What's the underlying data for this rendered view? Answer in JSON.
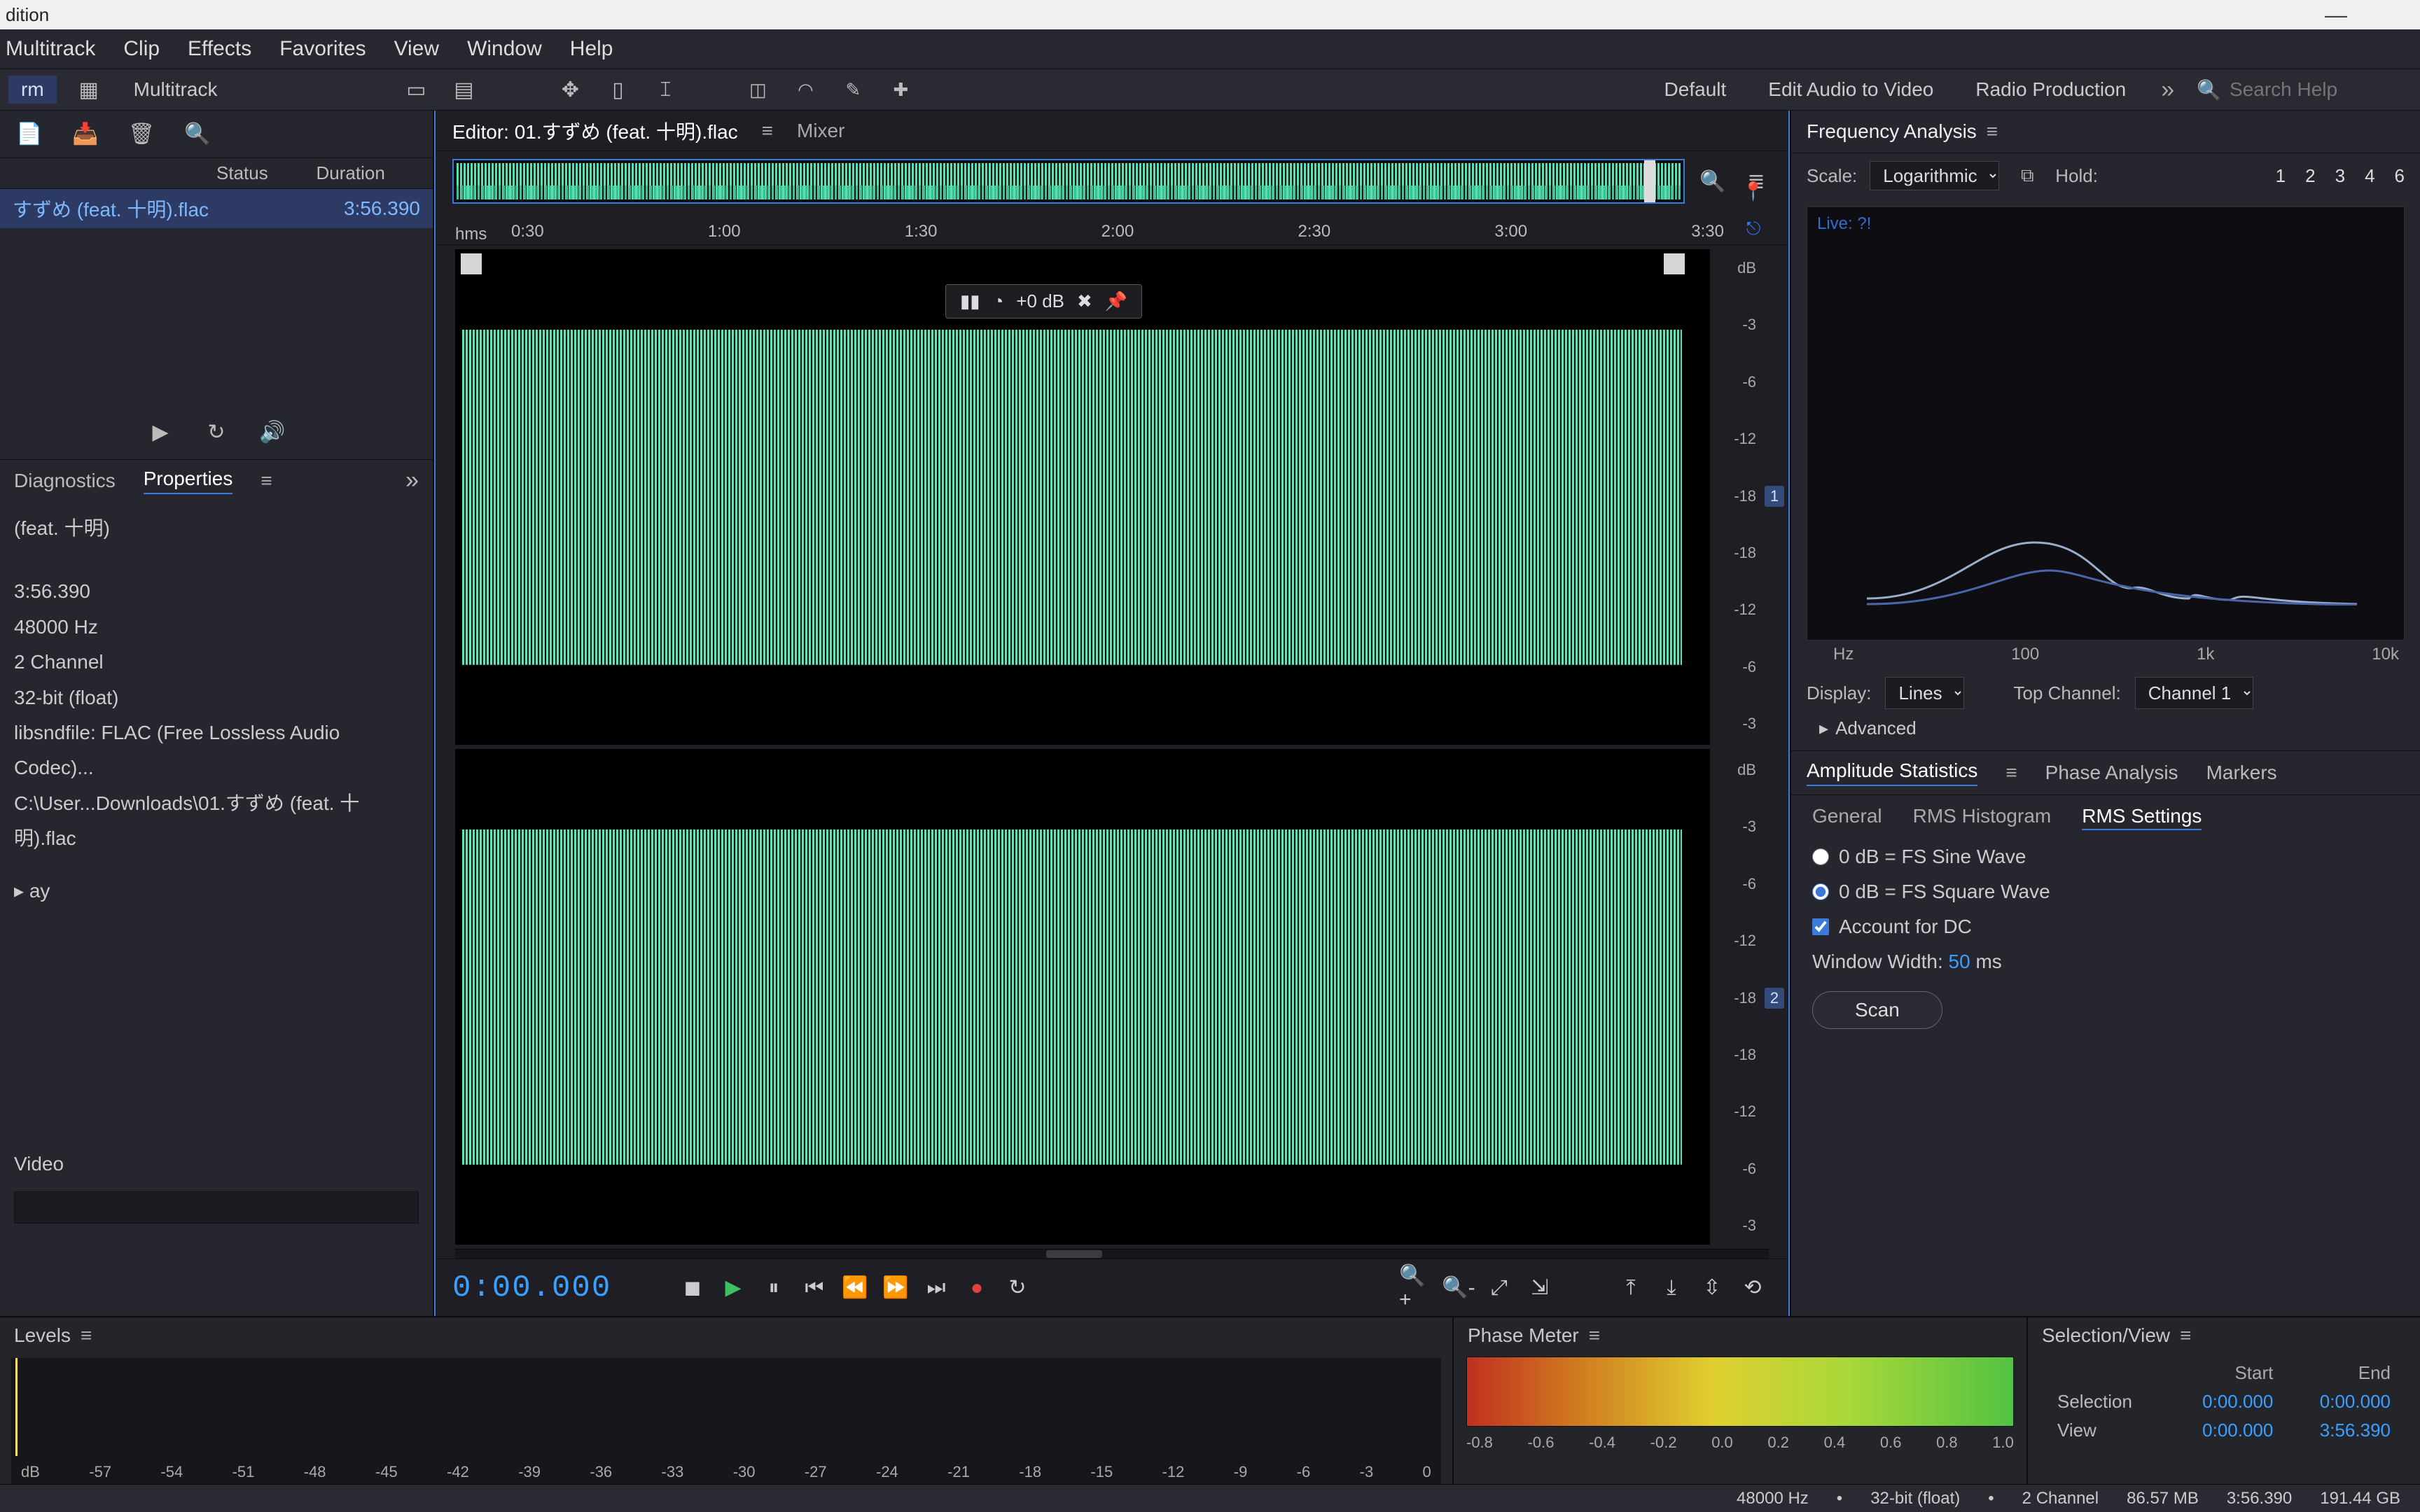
{
  "title_fragment": "dition",
  "menu": [
    "Multitrack",
    "Clip",
    "Effects",
    "Favorites",
    "View",
    "Window",
    "Help"
  ],
  "workspaces": {
    "left_mode1": "rm",
    "left_mode2": "Multitrack",
    "default": "Default",
    "edit_av": "Edit Audio to Video",
    "radio": "Radio Production",
    "search_placeholder": "Search Help"
  },
  "files": {
    "col_status": "Status",
    "col_duration": "Duration",
    "row": {
      "name": "すずめ (feat. 十明).flac",
      "duration": "3:56.390"
    }
  },
  "left_tabs": {
    "diag": "Diagnostics",
    "props": "Properties"
  },
  "properties": {
    "title_value": "(feat. 十明)",
    "duration": "3:56.390",
    "sample_rate": "48000 Hz",
    "channels": "2 Channel",
    "bit_depth": "32-bit (float)",
    "codec": "libsndfile: FLAC (Free Lossless Audio Codec)...",
    "path": "C:\\User...Downloads\\01.すずめ (feat. 十明).flac",
    "disclosure": "ay",
    "video": "Video"
  },
  "editor": {
    "tab_active": "Editor: 01.すずめ (feat. 十明).flac",
    "tab_mixer": "Mixer",
    "hud_db": "+0 dB",
    "timeline_label": "hms",
    "timeline_ticks": [
      "0:30",
      "1:00",
      "1:30",
      "2:00",
      "2:30",
      "3:00",
      "3:30"
    ],
    "db_ticks": [
      "dB",
      "-3",
      "-6",
      "-12",
      "-18",
      "-18",
      "-12",
      "-6",
      "-3"
    ],
    "ch1": "1",
    "ch2": "2",
    "timecode": "0:00.000"
  },
  "freq": {
    "title": "Frequency Analysis",
    "scale_label": "Scale:",
    "scale_value": "Logarithmic",
    "hold_label": "Hold:",
    "holds": [
      "1",
      "2",
      "3",
      "4",
      "6"
    ],
    "plot_label": "Live: ?!",
    "hz_label": "Hz",
    "axis": [
      "100",
      "1k",
      "10k"
    ],
    "display_label": "Display:",
    "display_value": "Lines",
    "topch_label": "Top Channel:",
    "topch_value": "Channel 1",
    "advanced": "Advanced"
  },
  "amp": {
    "t1": "Amplitude Statistics",
    "t2": "Phase Analysis",
    "t3": "Markers",
    "s1": "General",
    "s2": "RMS Histogram",
    "s3": "RMS Settings",
    "r1": "0 dB = FS Sine Wave",
    "r2": "0 dB = FS Square Wave",
    "cb": "Account for DC",
    "ww_label": "Window Width:",
    "ww_value": "50",
    "ww_unit": "ms",
    "scan": "Scan"
  },
  "levels": {
    "title": "Levels",
    "scale": [
      "dB",
      "-57",
      "-54",
      "-51",
      "-48",
      "-45",
      "-42",
      "-39",
      "-36",
      "-33",
      "-30",
      "-27",
      "-24",
      "-21",
      "-18",
      "-15",
      "-12",
      "-9",
      "-6",
      "-3",
      "0"
    ]
  },
  "phase": {
    "title": "Phase Meter",
    "scale": [
      "-0.8",
      "-0.6",
      "-0.4",
      "-0.2",
      "0.0",
      "0.2",
      "0.4",
      "0.6",
      "0.8",
      "1.0"
    ]
  },
  "selview": {
    "title": "Selection/View",
    "col_start": "Start",
    "col_end": "End",
    "row_sel": "Selection",
    "row_view": "View",
    "sel_start": "0:00.000",
    "sel_end": "0:00.000",
    "view_start": "0:00.000",
    "view_end": "3:56.390"
  },
  "status": {
    "s1": "48000 Hz",
    "s2": "32-bit (float)",
    "s3": "2 Channel",
    "s4": "86.57 MB",
    "s5": "3:56.390",
    "s6": "191.44 GB"
  }
}
